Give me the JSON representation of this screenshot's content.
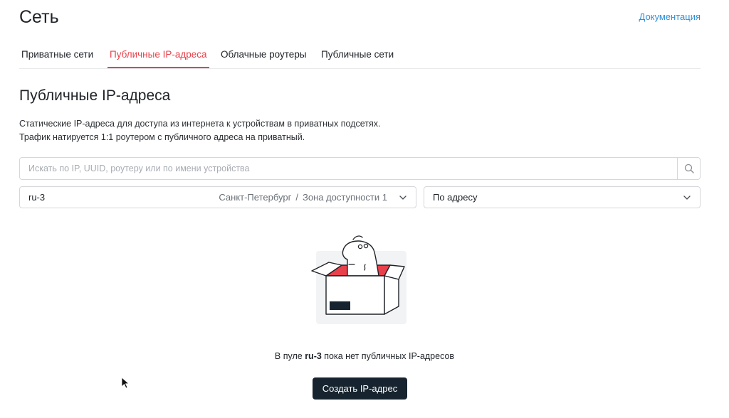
{
  "header": {
    "title": "Сеть",
    "doc_link": "Документация"
  },
  "tabs": [
    {
      "label": "Приватные сети",
      "active": false
    },
    {
      "label": "Публичные IP-адреса",
      "active": true
    },
    {
      "label": "Облачные роутеры",
      "active": false
    },
    {
      "label": "Публичные сети",
      "active": false
    }
  ],
  "section": {
    "title": "Публичные IP-адреса",
    "desc_line1": "Статические IP-адреса для доступа из интернета к устройствам в приватных подсетях.",
    "desc_line2": "Трафик натируется 1:1 роутером с публичного адреса на приватный."
  },
  "search": {
    "placeholder": "Искать по IP, UUID, роутеру или по имени устройства",
    "value": ""
  },
  "filters": {
    "region": {
      "value": "ru-3",
      "city": "Санкт-Петербург",
      "separator": "/",
      "zone": "Зона доступности 1"
    },
    "sort": {
      "value": "По адресу"
    }
  },
  "empty_state": {
    "prefix": "В пуле ",
    "pool": "ru-3",
    "suffix": " пока нет публичных IP-адресов",
    "button": "Создать IP-адрес"
  },
  "colors": {
    "accent": "#e8414b",
    "link": "#2f8fd8",
    "button_bg": "#17242f"
  },
  "icons": {
    "search": "search-icon",
    "chevron": "chevron-down-icon"
  }
}
